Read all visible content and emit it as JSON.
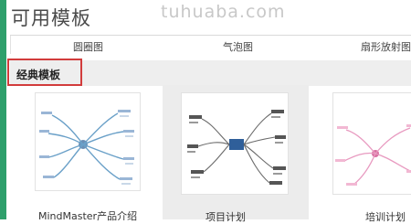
{
  "header": {
    "title": "可用模板",
    "watermark": "tuhuaba.com"
  },
  "top_row": {
    "items": [
      {
        "label": "圆圈图"
      },
      {
        "label": "气泡图"
      },
      {
        "label": "扇形放射图"
      }
    ]
  },
  "section": {
    "title": "经典模板"
  },
  "templates": [
    {
      "label": "MindMaster产品介绍"
    },
    {
      "label": "项目计划"
    },
    {
      "label": "培训计划"
    }
  ],
  "colors": {
    "accent_left": "#2e9f6b",
    "highlight_border": "#d23c3c",
    "section_bg": "#eeeeee",
    "selected_card_bg": "#ececec"
  }
}
